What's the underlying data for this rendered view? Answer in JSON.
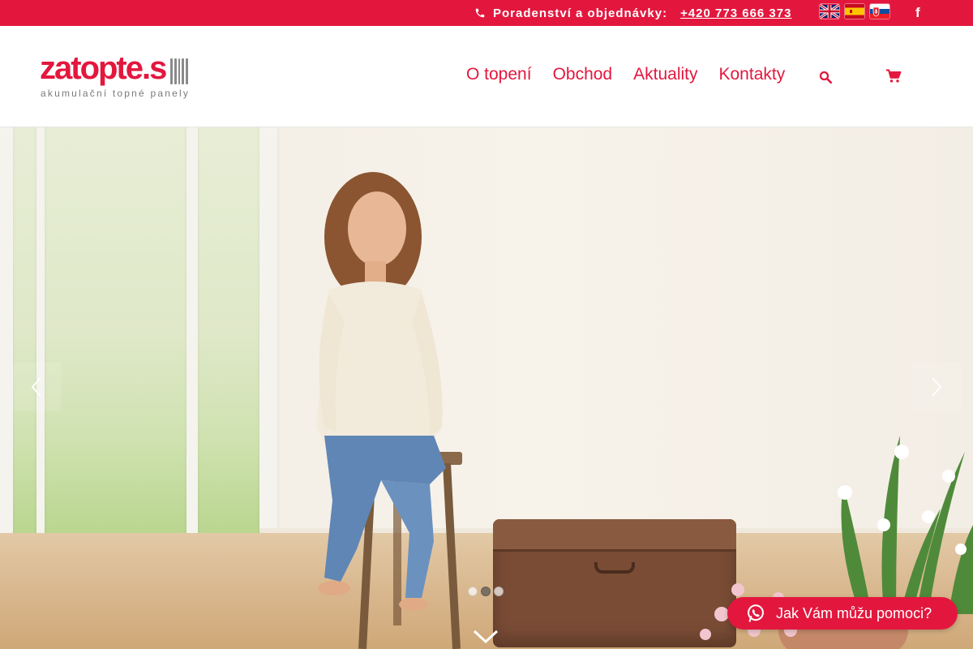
{
  "topbar": {
    "contact_label": "Poradenství a objednávky:",
    "phone": "+420 773 666 373",
    "languages": [
      "English",
      "Español",
      "Slovenčina"
    ],
    "social": "f"
  },
  "header": {
    "logo": {
      "name": "zatopte.s",
      "tagline": "akumulační topné panely"
    },
    "nav": [
      "O topení",
      "Obchod",
      "Aktuality",
      "Kontakty"
    ],
    "search_icon": "search-icon",
    "cart_icon": "cart-icon"
  },
  "hero": {
    "slides_count": 3,
    "active_slide": 2,
    "prev_icon": "chevron-left-icon",
    "next_icon": "chevron-right-icon",
    "scroll_icon": "chevron-down-icon"
  },
  "chat": {
    "label": "Jak Vám můžu pomoci?",
    "icon": "whatsapp-icon"
  },
  "colors": {
    "brand": "#e3173e",
    "white": "#ffffff"
  }
}
